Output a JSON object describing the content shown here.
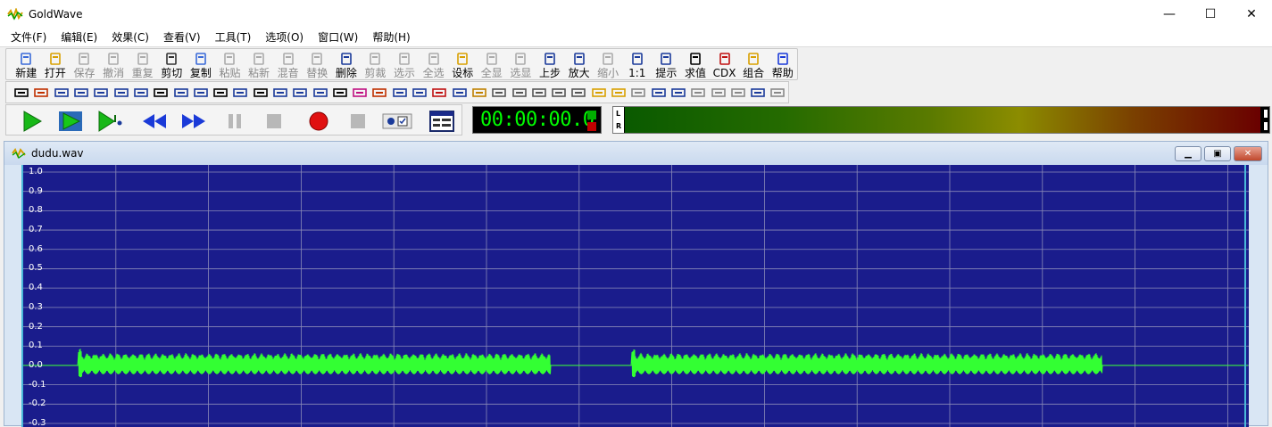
{
  "app": {
    "title": "GoldWave"
  },
  "window_controls": {
    "minimize": "—",
    "maximize": "☐",
    "close": "✕"
  },
  "menu": [
    "文件(F)",
    "编辑(E)",
    "效果(C)",
    "查看(V)",
    "工具(T)",
    "选项(O)",
    "窗口(W)",
    "帮助(H)"
  ],
  "toolbar_main": [
    {
      "label": "新建",
      "icon": "new-file-icon",
      "enabled": true
    },
    {
      "label": "打开",
      "icon": "open-folder-icon",
      "enabled": true
    },
    {
      "label": "保存",
      "icon": "save-icon",
      "enabled": false
    },
    {
      "label": "撤消",
      "icon": "undo-icon",
      "enabled": false
    },
    {
      "label": "重复",
      "icon": "redo-icon",
      "enabled": false
    },
    {
      "label": "剪切",
      "icon": "scissors-icon",
      "enabled": true
    },
    {
      "label": "复制",
      "icon": "copy-icon",
      "enabled": true
    },
    {
      "label": "粘贴",
      "icon": "paste-icon",
      "enabled": false
    },
    {
      "label": "粘新",
      "icon": "paste-new-icon",
      "enabled": false
    },
    {
      "label": "混音",
      "icon": "mix-icon",
      "enabled": false
    },
    {
      "label": "替换",
      "icon": "replace-icon",
      "enabled": false
    },
    {
      "label": "删除",
      "icon": "delete-icon",
      "enabled": true
    },
    {
      "label": "剪裁",
      "icon": "trim-icon",
      "enabled": false
    },
    {
      "label": "选示",
      "icon": "show-selection-icon",
      "enabled": false
    },
    {
      "label": "全选",
      "icon": "select-all-icon",
      "enabled": false
    },
    {
      "label": "设标",
      "icon": "set-marker-icon",
      "enabled": true
    },
    {
      "label": "全显",
      "icon": "show-all-icon",
      "enabled": false
    },
    {
      "label": "选显",
      "icon": "zoom-selection-icon",
      "enabled": false
    },
    {
      "label": "上步",
      "icon": "previous-zoom-icon",
      "enabled": true
    },
    {
      "label": "放大",
      "icon": "zoom-in-icon",
      "enabled": true
    },
    {
      "label": "缩小",
      "icon": "zoom-out-icon",
      "enabled": false
    },
    {
      "label": "1:1",
      "icon": "zoom-1-1-icon",
      "enabled": true
    },
    {
      "label": "提示",
      "icon": "cue-icon",
      "enabled": true
    },
    {
      "label": "求值",
      "icon": "evaluate-icon",
      "enabled": true
    },
    {
      "label": "CDX",
      "icon": "cd-icon",
      "enabled": true
    },
    {
      "label": "组合",
      "icon": "combine-icon",
      "enabled": true
    },
    {
      "label": "帮助",
      "icon": "help-icon",
      "enabled": true
    }
  ],
  "toolbar_effects_count": 39,
  "transport": {
    "play": "play-icon",
    "play_selection": "play-selection-icon",
    "play_from_cursor": "play-cursor-icon",
    "rewind": "rewind-icon",
    "fast_forward": "fast-forward-icon",
    "pause": "pause-icon",
    "stop": "stop-icon",
    "record": "record-icon",
    "stop_record": "stop-record-icon",
    "settings": "record-settings-icon",
    "window": "control-window-icon"
  },
  "time_display": "00:00:00.0",
  "meter": {
    "left_label": "L",
    "right_label": "R"
  },
  "document": {
    "title": "dudu.wav",
    "y_axis_labels": [
      "1.0",
      "0.9",
      "0.8",
      "0.7",
      "0.6",
      "0.5",
      "0.4",
      "0.3",
      "0.2",
      "0.1",
      "0.0",
      "-0.1",
      "-0.2",
      "-0.3"
    ],
    "colors": {
      "background": "#1a1c8c",
      "wave": "#33ff33",
      "grid": "#8a8ab8"
    }
  },
  "chart_data": {
    "type": "line",
    "ylim": [
      -0.3,
      1.0
    ],
    "bursts": [
      {
        "start_fraction": 0.045,
        "end_fraction": 0.43,
        "amplitude": 0.14
      },
      {
        "start_fraction": 0.496,
        "end_fraction": 0.88,
        "amplitude": 0.14
      }
    ]
  }
}
